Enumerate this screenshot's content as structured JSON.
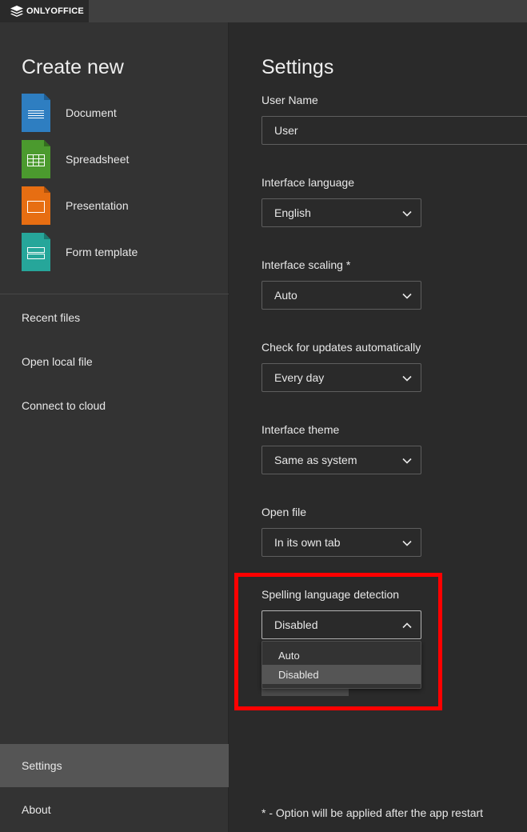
{
  "app": {
    "brand": "ONLYOFFICE"
  },
  "sidebar": {
    "create_title": "Create new",
    "create_items": [
      {
        "label": "Document",
        "icon": "document-icon",
        "color": "#2e7ec1"
      },
      {
        "label": "Spreadsheet",
        "icon": "spreadsheet-icon",
        "color": "#4b9a2e"
      },
      {
        "label": "Presentation",
        "icon": "presentation-icon",
        "color": "#e76e12"
      },
      {
        "label": "Form template",
        "icon": "form-template-icon",
        "color": "#26a69a"
      }
    ],
    "nav": [
      {
        "label": "Recent files"
      },
      {
        "label": "Open local file"
      },
      {
        "label": "Connect to cloud"
      }
    ],
    "bottom_nav": [
      {
        "label": "Settings",
        "active": true
      },
      {
        "label": "About",
        "active": false
      }
    ]
  },
  "settings": {
    "title": "Settings",
    "user_name": {
      "label": "User Name",
      "value": "User"
    },
    "interface_language": {
      "label": "Interface language",
      "value": "English"
    },
    "interface_scaling": {
      "label": "Interface scaling *",
      "value": "Auto"
    },
    "check_updates": {
      "label": "Check for updates automatically",
      "value": "Every day"
    },
    "interface_theme": {
      "label": "Interface theme",
      "value": "Same as system"
    },
    "open_file": {
      "label": "Open file",
      "value": "In its own tab"
    },
    "spelling_detection": {
      "label": "Spelling language detection",
      "value": "Disabled",
      "options": [
        "Auto",
        "Disabled"
      ],
      "selected": "Disabled"
    },
    "footnote": "* - Option will be applied after the app restart"
  },
  "colors": {
    "highlight": "#ff0000",
    "active_nav": "#555555"
  }
}
